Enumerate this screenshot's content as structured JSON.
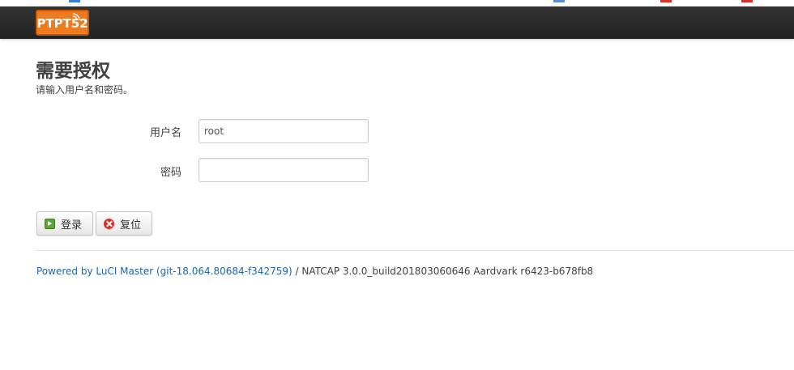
{
  "header": {
    "logo_text": "PTPT52",
    "colors": {
      "navbar": "#222222",
      "logo_bg": "#ee7b1f"
    }
  },
  "auth": {
    "title": "需要授权",
    "description": "请输入用户名和密码。",
    "username_label": "用户名",
    "username_value": "root",
    "password_label": "密码",
    "password_value": ""
  },
  "buttons": {
    "login_label": "登录",
    "login_icon": "apply-icon",
    "reset_label": "复位",
    "reset_icon": "reset-icon"
  },
  "footer": {
    "link_text": "Powered by LuCI Master (git-18.064.80684-f342759)",
    "separator": " / ",
    "build_text": "NATCAP 3.0.0_build201803060646 Aardvark r6423-b678fb8",
    "link_color": "#2266aa"
  }
}
